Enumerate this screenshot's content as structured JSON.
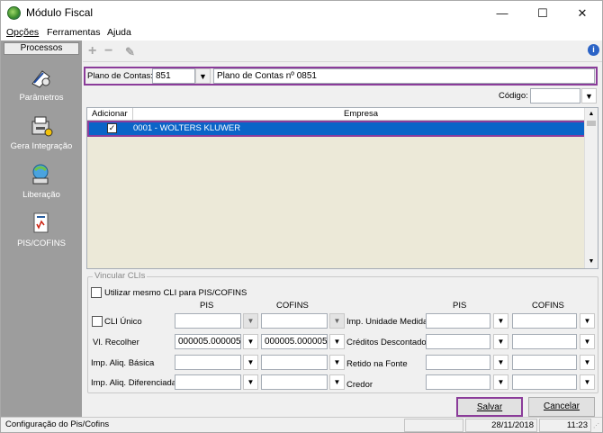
{
  "window": {
    "title": "Módulo Fiscal",
    "minimize": "—",
    "maximize": "☐",
    "close": "✕"
  },
  "menu": [
    "Opções",
    "Ferramentas",
    "Ajuda"
  ],
  "sidebar": {
    "header": "Processos",
    "items": [
      {
        "label": "Parâmetros",
        "icon": "parametros-icon"
      },
      {
        "label": "Gera Integração",
        "icon": "gera-integracao-icon"
      },
      {
        "label": "Liberação",
        "icon": "liberacao-icon"
      },
      {
        "label": "PIS/COFINS",
        "icon": "pis-cofins-icon"
      }
    ]
  },
  "toolbar": {
    "add": "+",
    "remove": "−",
    "edit": "✎",
    "info": "i"
  },
  "plano": {
    "label": "Plano de Contas:",
    "value": "851",
    "description": "Plano de Contas nº 0851"
  },
  "codigo": {
    "label": "Código:",
    "value": ""
  },
  "grid": {
    "headers": [
      "Adicionar",
      "Empresa"
    ],
    "rows": [
      {
        "checked": true,
        "empresa": "0001 - WOLTERS KLUWER"
      }
    ]
  },
  "vincular": {
    "title": "Vincular CLIs",
    "same_cli_label": "Utilizar mesmo CLI para PIS/COFINS",
    "col_pis": "PIS",
    "col_cofins": "COFINS",
    "left_rows": [
      {
        "label": "CLI Único",
        "pis": "",
        "cofins": "",
        "checkbox": true
      },
      {
        "label": "Vl. Recolher",
        "pis": "000005.000005",
        "cofins": "000005.000005",
        "checkbox": false
      },
      {
        "label": "Imp. Aliq. Básica",
        "pis": "",
        "cofins": "",
        "checkbox": false
      },
      {
        "label": "Imp. Aliq. Diferenciada",
        "pis": "",
        "cofins": "",
        "checkbox": false
      }
    ],
    "right_rows": [
      {
        "label": "Imp. Unidade Medida",
        "pis": "",
        "cofins": ""
      },
      {
        "label": "Créditos Descontados",
        "pis": "",
        "cofins": ""
      },
      {
        "label": "Retido na Fonte",
        "pis": "",
        "cofins": ""
      },
      {
        "label": "Credor",
        "pis": "",
        "cofins": ""
      }
    ]
  },
  "buttons": {
    "save": "Salvar",
    "cancel": "Cancelar"
  },
  "status": {
    "message": "Configuração do Pis/Cofins",
    "date": "28/11/2018",
    "time": "11:23"
  },
  "colors": {
    "selection": "#0a64c8",
    "highlight_border": "#8b3c9a",
    "sidebar": "#9d9d9d"
  }
}
